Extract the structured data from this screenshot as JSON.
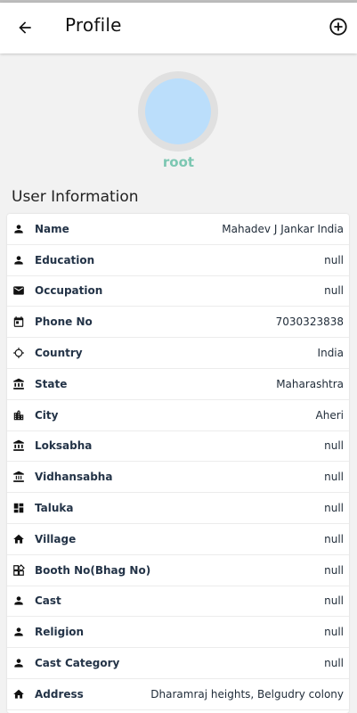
{
  "header": {
    "title": "Profile",
    "back_icon": "arrow-left-icon",
    "add_icon": "add-circle-icon"
  },
  "profile": {
    "username": "root",
    "avatar_color": "#bbdefb",
    "username_color": "#7cc7b2"
  },
  "section": {
    "title": "User Information"
  },
  "rows": [
    {
      "icon": "person-icon",
      "label": "Name",
      "value": "Mahadev J Jankar India"
    },
    {
      "icon": "person-icon",
      "label": "Education",
      "value": "null"
    },
    {
      "icon": "mail-icon",
      "label": "Occupation",
      "value": "null"
    },
    {
      "icon": "calendar-icon",
      "label": "Phone No",
      "value": "7030323838"
    },
    {
      "icon": "gps-icon",
      "label": "Country",
      "value": "India"
    },
    {
      "icon": "bank-icon",
      "label": "State",
      "value": "Maharashtra"
    },
    {
      "icon": "city-icon",
      "label": "City",
      "value": "Aheri"
    },
    {
      "icon": "bank-icon",
      "label": "Loksabha",
      "value": "null"
    },
    {
      "icon": "bank-outline-icon",
      "label": "Vidhansabha",
      "value": "null"
    },
    {
      "icon": "dashboard-icon",
      "label": "Taluka",
      "value": "null"
    },
    {
      "icon": "home-icon",
      "label": "Village",
      "value": "null"
    },
    {
      "icon": "widgets-icon",
      "label": "Booth No(Bhag No)",
      "value": "null"
    },
    {
      "icon": "person-icon",
      "label": "Cast",
      "value": "null"
    },
    {
      "icon": "person-icon",
      "label": "Religion",
      "value": "null"
    },
    {
      "icon": "person-icon",
      "label": "Cast Category",
      "value": "null"
    },
    {
      "icon": "home-icon",
      "label": "Address",
      "value": "Dharamraj heights, Belgudry colony"
    }
  ]
}
